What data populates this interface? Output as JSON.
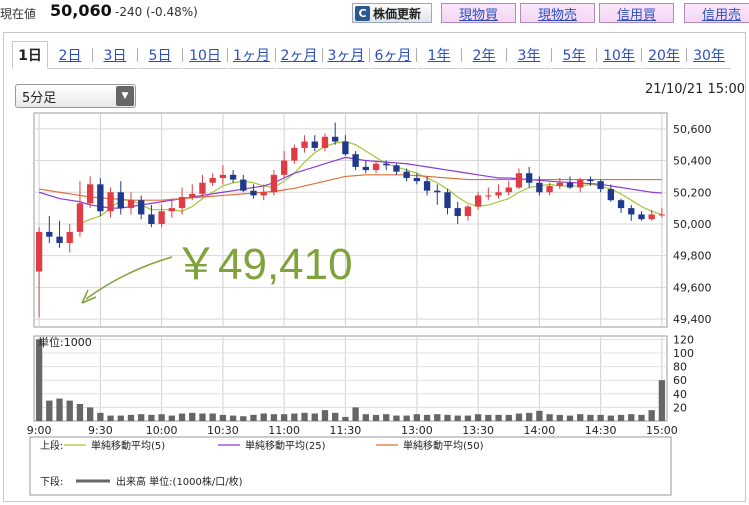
{
  "header": {
    "price_label": "現在値",
    "price_value": "50,060",
    "price_change": "-240 (-0.48%)",
    "refresh_label": "株価更新",
    "buttons": [
      "現物買",
      "現物売",
      "信用買",
      "信用売"
    ]
  },
  "tabs": [
    "1日",
    "2日",
    "3日",
    "5日",
    "10日",
    "1ヶ月",
    "2ヶ月",
    "3ヶ月",
    "6ヶ月",
    "1年",
    "2年",
    "3年",
    "5年",
    "10年",
    "20年",
    "30年"
  ],
  "active_tab": "1日",
  "interval": {
    "selected": "5分足"
  },
  "timestamp": "21/10/21 15:00",
  "annotation": "￥49,410",
  "legend": {
    "upper_label": "上段:",
    "lower_label": "下段:",
    "ma": [
      {
        "label": "単純移動平均(5)",
        "color": "#a6c33a"
      },
      {
        "label": "単純移動平均(25)",
        "color": "#8b3ad6"
      },
      {
        "label": "単純移動平均(50)",
        "color": "#e0703a"
      }
    ],
    "volume_label": "出来高 単位:(1000株/口/枚)"
  },
  "colors": {
    "up": "#e03c46",
    "down": "#1f3a8c",
    "volume": "#666666"
  },
  "chart_data": [
    {
      "type": "candlestick",
      "x": [
        "9:00",
        "9:05",
        "9:10",
        "9:15",
        "9:20",
        "9:25",
        "9:30",
        "9:35",
        "9:40",
        "9:45",
        "9:50",
        "9:55",
        "10:00",
        "10:05",
        "10:10",
        "10:15",
        "10:20",
        "10:25",
        "10:30",
        "10:35",
        "10:40",
        "10:45",
        "10:50",
        "10:55",
        "11:00",
        "11:05",
        "11:10",
        "11:15",
        "11:20",
        "11:25",
        "11:30",
        "12:30",
        "12:35",
        "12:40",
        "12:45",
        "12:50",
        "12:55",
        "13:00",
        "13:05",
        "13:10",
        "13:15",
        "13:20",
        "13:25",
        "13:30",
        "13:35",
        "13:40",
        "13:45",
        "13:50",
        "13:55",
        "14:00",
        "14:05",
        "14:10",
        "14:15",
        "14:20",
        "14:25",
        "14:30",
        "14:35",
        "14:40",
        "14:45",
        "14:50",
        "14:55",
        "15:00"
      ],
      "open": [
        49700,
        49950,
        49920,
        49880,
        49950,
        50130,
        50250,
        50080,
        50200,
        50100,
        50150,
        50060,
        50000,
        50080,
        50100,
        50170,
        50190,
        50260,
        50290,
        50310,
        50280,
        50210,
        50180,
        50200,
        50310,
        50400,
        50480,
        50520,
        50480,
        50550,
        50520,
        50440,
        50360,
        50340,
        50380,
        50370,
        50330,
        50290,
        50270,
        50210,
        50200,
        50100,
        50050,
        50110,
        50180,
        50180,
        50200,
        50230,
        50320,
        50260,
        50200,
        50240,
        50260,
        50230,
        50280,
        50270,
        50220,
        50150,
        50100,
        50060,
        50030,
        50060
      ],
      "high": [
        49980,
        50050,
        50020,
        50000,
        50270,
        50300,
        50290,
        50230,
        50270,
        50200,
        50180,
        50120,
        50120,
        50160,
        50230,
        50250,
        50310,
        50320,
        50370,
        50340,
        50310,
        50250,
        50250,
        50340,
        50460,
        50500,
        50560,
        50560,
        50570,
        50640,
        50560,
        50460,
        50400,
        50400,
        50400,
        50380,
        50350,
        50320,
        50300,
        50250,
        50220,
        50140,
        50120,
        50200,
        50230,
        50250,
        50270,
        50350,
        50360,
        50300,
        50260,
        50290,
        50300,
        50290,
        50300,
        50280,
        50250,
        50160,
        50120,
        50080,
        50090,
        50100
      ],
      "high_low_note": "",
      "low": [
        49410,
        49880,
        49850,
        49820,
        49920,
        50100,
        50050,
        50040,
        50060,
        50060,
        50030,
        49980,
        49980,
        50040,
        50060,
        50150,
        50170,
        50240,
        50250,
        50260,
        50200,
        50160,
        50150,
        50180,
        50290,
        50380,
        50450,
        50460,
        50460,
        50500,
        50430,
        50340,
        50320,
        50320,
        50340,
        50310,
        50270,
        50250,
        50180,
        50120,
        50060,
        50000,
        50020,
        50090,
        50150,
        50160,
        50180,
        50220,
        50230,
        50180,
        50180,
        50220,
        50220,
        50200,
        50240,
        50200,
        50140,
        50070,
        50020,
        50020,
        50020,
        50040
      ],
      "close": [
        49950,
        49920,
        49880,
        49950,
        50130,
        50250,
        50080,
        50200,
        50100,
        50150,
        50060,
        50000,
        50080,
        50100,
        50170,
        50190,
        50260,
        50290,
        50310,
        50280,
        50210,
        50180,
        50200,
        50310,
        50400,
        50480,
        50520,
        50480,
        50550,
        50520,
        50440,
        50360,
        50340,
        50380,
        50370,
        50330,
        50290,
        50270,
        50210,
        50200,
        50100,
        50050,
        50110,
        50180,
        50180,
        50200,
        50230,
        50320,
        50260,
        50200,
        50240,
        50260,
        50230,
        50280,
        50270,
        50220,
        50150,
        50100,
        50060,
        50030,
        50060,
        50060
      ],
      "ma5": [
        null,
        null,
        null,
        null,
        50000,
        50030,
        50050,
        50100,
        50150,
        50150,
        50120,
        50090,
        50090,
        50090,
        50080,
        50110,
        50160,
        50200,
        50240,
        50260,
        50270,
        50260,
        50240,
        50230,
        50270,
        50320,
        50390,
        50450,
        50490,
        50510,
        50520,
        50500,
        50460,
        50420,
        50380,
        50360,
        50340,
        50320,
        50290,
        50260,
        50220,
        50170,
        50130,
        50110,
        50120,
        50140,
        50160,
        50200,
        50230,
        50240,
        50250,
        50240,
        50240,
        50240,
        50250,
        50240,
        50220,
        50190,
        50150,
        50110,
        50080,
        50060
      ],
      "ma25": [
        50200,
        50180,
        50160,
        50150,
        50140,
        50120,
        50110,
        50100,
        50100,
        50110,
        50120,
        50130,
        50140,
        50150,
        50160,
        50170,
        50180,
        50190,
        50200,
        50210,
        50220,
        50230,
        50240,
        50260,
        50290,
        50320,
        50340,
        50360,
        50380,
        50400,
        50420,
        50410,
        50400,
        50395,
        50390,
        50385,
        50380,
        50370,
        50360,
        50350,
        50340,
        50330,
        50320,
        50310,
        50300,
        50290,
        50290,
        50285,
        50280,
        50275,
        50270,
        50265,
        50262,
        50258,
        50255,
        50250,
        50240,
        50230,
        50220,
        50210,
        50200,
        50195
      ],
      "ma50": [
        50220,
        50210,
        50200,
        50190,
        50180,
        50170,
        50165,
        50160,
        50155,
        50150,
        50150,
        50150,
        50150,
        50155,
        50160,
        50165,
        50170,
        50175,
        50180,
        50185,
        50190,
        50195,
        50200,
        50205,
        50215,
        50225,
        50240,
        50255,
        50270,
        50285,
        50300,
        50305,
        50310,
        50310,
        50310,
        50310,
        50310,
        50305,
        50300,
        50295,
        50290,
        50285,
        50280,
        50280,
        50280,
        50280,
        50280,
        50280,
        50280,
        50280,
        50280,
        50280,
        50280,
        50280,
        50280,
        50280,
        50280,
        50280,
        50280,
        50280,
        50280,
        50280
      ],
      "x_ticks": [
        "9:00",
        "9:30",
        "10:00",
        "10:30",
        "11:00",
        "11:30",
        "13:00",
        "13:30",
        "14:00",
        "14:30",
        "15:00"
      ],
      "ylim": [
        49350,
        50700
      ],
      "y_ticks": [
        49400,
        49600,
        49800,
        50000,
        50200,
        50400,
        50600
      ],
      "y_tick_labels": [
        "49,400",
        "49,600",
        "49,800",
        "50,000",
        "50,200",
        "50,400",
        "50,600"
      ]
    },
    {
      "type": "bar",
      "x": [
        "9:00",
        "9:05",
        "9:10",
        "9:15",
        "9:20",
        "9:25",
        "9:30",
        "9:35",
        "9:40",
        "9:45",
        "9:50",
        "9:55",
        "10:00",
        "10:05",
        "10:10",
        "10:15",
        "10:20",
        "10:25",
        "10:30",
        "10:35",
        "10:40",
        "10:45",
        "10:50",
        "10:55",
        "11:00",
        "11:05",
        "11:10",
        "11:15",
        "11:20",
        "11:25",
        "11:30",
        "12:30",
        "12:35",
        "12:40",
        "12:45",
        "12:50",
        "12:55",
        "13:00",
        "13:05",
        "13:10",
        "13:15",
        "13:20",
        "13:25",
        "13:30",
        "13:35",
        "13:40",
        "13:45",
        "13:50",
        "13:55",
        "14:00",
        "14:05",
        "14:10",
        "14:15",
        "14:20",
        "14:25",
        "14:30",
        "14:35",
        "14:40",
        "14:45",
        "14:50",
        "14:55",
        "15:00"
      ],
      "values": [
        120,
        30,
        33,
        30,
        25,
        20,
        12,
        8,
        8,
        9,
        10,
        9,
        10,
        8,
        11,
        12,
        11,
        11,
        9,
        8,
        7,
        9,
        11,
        10,
        10,
        11,
        12,
        11,
        16,
        12,
        6,
        20,
        10,
        9,
        10,
        8,
        8,
        10,
        9,
        10,
        9,
        8,
        8,
        10,
        9,
        9,
        9,
        11,
        12,
        15,
        10,
        9,
        8,
        10,
        9,
        9,
        8,
        9,
        10,
        9,
        16,
        60
      ],
      "ylim": [
        0,
        125
      ],
      "y_ticks": [
        20,
        40,
        60,
        80,
        100,
        120
      ],
      "unit_label": "単位:",
      "unit_value": "1000"
    }
  ]
}
